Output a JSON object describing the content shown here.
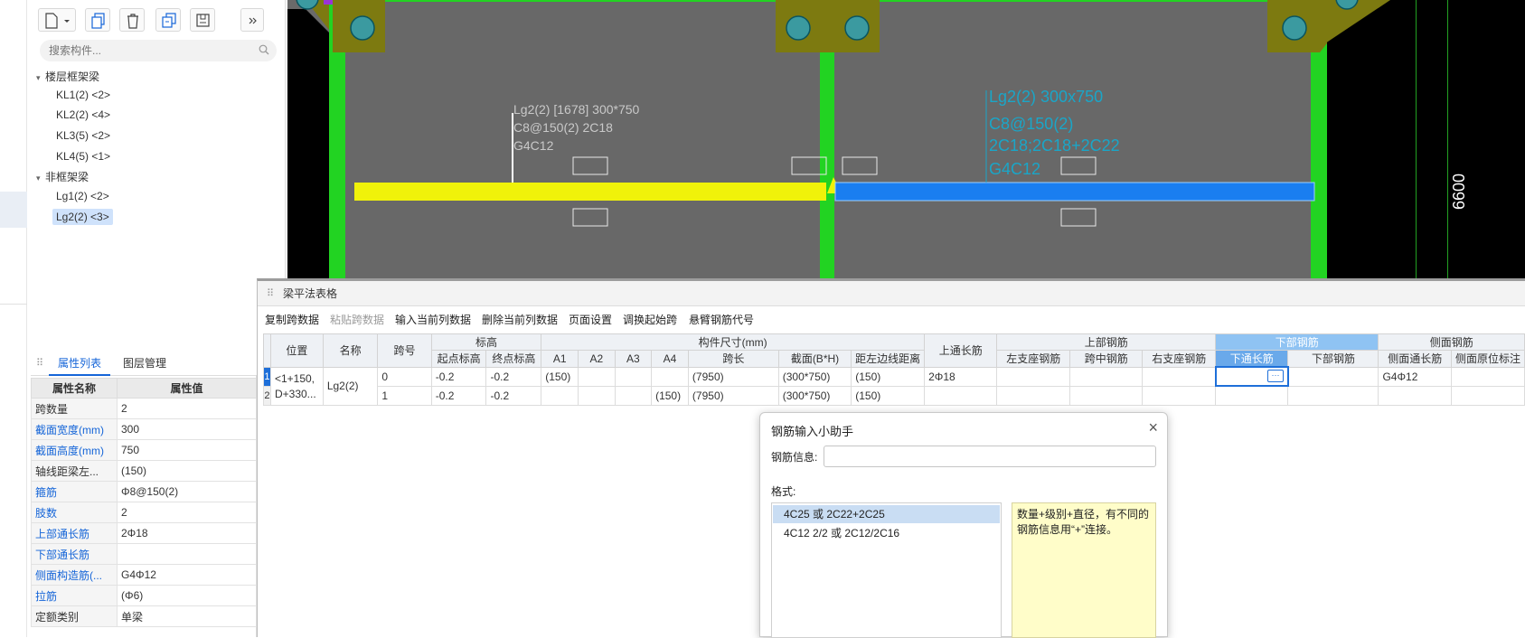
{
  "left_panel": {
    "search_placeholder": "搜索构件...",
    "groups": [
      {
        "label": "楼层框架梁",
        "items": [
          "KL1(2) <2>",
          "KL2(2) <4>",
          "KL3(5) <2>",
          "KL4(5) <1>"
        ]
      },
      {
        "label": "非框架梁",
        "items": [
          "Lg1(2) <2>",
          "Lg2(2) <3>"
        ]
      }
    ],
    "selected_item": "Lg2(2) <3>"
  },
  "prop_panel": {
    "tabs": [
      "属性列表",
      "图层管理"
    ],
    "header": {
      "name": "属性名称",
      "value": "属性值"
    },
    "rows": [
      {
        "name": "跨数量",
        "value": "2"
      },
      {
        "name": "截面宽度(mm)",
        "value": "300"
      },
      {
        "name": "截面高度(mm)",
        "value": "750"
      },
      {
        "name": "轴线距梁左...",
        "value": "(150)"
      },
      {
        "name": "箍筋",
        "value": "Φ8@150(2)"
      },
      {
        "name": "肢数",
        "value": "2"
      },
      {
        "name": "上部通长筋",
        "value": "2Φ18"
      },
      {
        "name": "下部通长筋",
        "value": ""
      },
      {
        "name": "侧面构造筋(...",
        "value": "G4Φ12"
      },
      {
        "name": "拉筋",
        "value": "(Φ6)"
      },
      {
        "name": "定额类别",
        "value": "单梁"
      }
    ]
  },
  "canvas": {
    "annotation_left": [
      "Lg2(2) [1678] 300*750",
      "C8@150(2) 2C18",
      "G4C12"
    ],
    "annotation_right": [
      "Lg2(2) 300x750",
      "C8@150(2)",
      "2C18;2C18+2C22",
      "G4C12"
    ],
    "dimension": "6600",
    "colors": {
      "column": "#22d322",
      "beam_selected": "#f0f20a",
      "beam_active": "#1a7ef0",
      "slab": "#686868",
      "base_plate": "#7d7a10"
    }
  },
  "beam_panel": {
    "title": "梁平法表格",
    "toolbar": [
      "复制跨数据",
      "粘贴跨数据",
      "输入当前列数据",
      "删除当前列数据",
      "页面设置",
      "调换起始跨",
      "悬臂钢筋代号"
    ],
    "headers": {
      "position": "位置",
      "name": "名称",
      "span": "跨号",
      "elevation": "标高",
      "start_elev": "起点标高",
      "end_elev": "终点标高",
      "dims": "构件尺寸(mm)",
      "a1": "A1",
      "a2": "A2",
      "a3": "A3",
      "a4": "A4",
      "span_len": "跨长",
      "section": "截面(B*H)",
      "edge_dist": "距左边线距离",
      "top_through": "上通长筋",
      "top_rebar": "上部钢筋",
      "left_support": "左支座钢筋",
      "mid_span": "跨中钢筋",
      "right_support": "右支座钢筋",
      "bottom_rebar": "下部钢筋",
      "bottom_through": "下通长筋",
      "bottom_bar": "下部钢筋",
      "side_rebar": "侧面钢筋",
      "side_through": "侧面通长筋",
      "side_local": "侧面原位标注"
    },
    "rows": [
      {
        "rn": "1",
        "position": "<1+150,",
        "position2": "D+330...",
        "name": "Lg2(2)",
        "span": "0",
        "start_elev": "-0.2",
        "end_elev": "-0.2",
        "a1": "(150)",
        "a2": "",
        "a3": "",
        "a4": "",
        "span_len": "(7950)",
        "section": "(300*750)",
        "edge_dist": "(150)",
        "top_through": "2Φ18",
        "side_through": "G4Φ12"
      },
      {
        "rn": "2",
        "span": "1",
        "start_elev": "-0.2",
        "end_elev": "-0.2",
        "a1": "",
        "a2": "",
        "a3": "",
        "a4": "(150)",
        "span_len": "(7950)",
        "section": "(300*750)",
        "edge_dist": "(150)",
        "top_through": "",
        "side_through": ""
      }
    ],
    "cell_button": "···"
  },
  "dialog": {
    "title": "钢筋输入小助手",
    "info_label": "钢筋信息:",
    "info_value": "",
    "format_label": "格式:",
    "formats": [
      "4C25 或 2C22+2C25",
      "4C12 2/2 或 2C12/2C16"
    ],
    "help": "数量+级别+直径，有不同的钢筋信息用“+”连接。"
  }
}
